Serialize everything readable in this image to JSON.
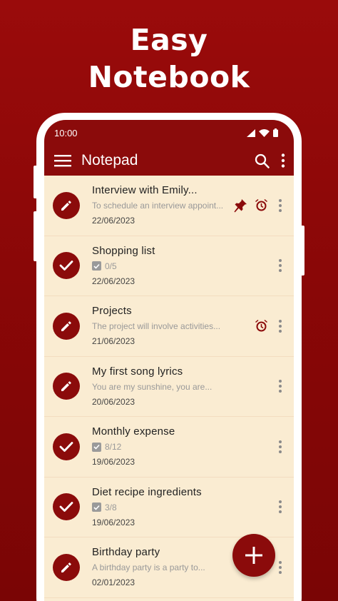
{
  "promo": {
    "line1": "Easy",
    "line2": "Notebook"
  },
  "status_bar": {
    "time": "10:00",
    "icons": [
      "signal-icon",
      "wifi-icon",
      "battery-icon"
    ]
  },
  "app_bar": {
    "title": "Notepad",
    "menu_icon": "hamburger-menu-icon",
    "search_icon": "search-icon",
    "more_icon": "more-vert-icon"
  },
  "colors": {
    "primary": "#8b0b0b",
    "background": "#faecd2",
    "promo_bg": "#8a0707"
  },
  "notes": [
    {
      "title": "Interview with Emily...",
      "preview": "To schedule an interview appoint...",
      "date": "22/06/2023",
      "type": "text",
      "pinned": true,
      "alarm": true
    },
    {
      "title": "Shopping list",
      "checklist": "0/5",
      "date": "22/06/2023",
      "type": "checklist"
    },
    {
      "title": "Projects",
      "preview": "The project will involve activities...",
      "date": "21/06/2023",
      "type": "text",
      "alarm": true
    },
    {
      "title": "My first song lyrics",
      "preview": "You are my sunshine, you are...",
      "date": "20/06/2023",
      "type": "text"
    },
    {
      "title": "Monthly expense",
      "checklist": "8/12",
      "date": "19/06/2023",
      "type": "checklist"
    },
    {
      "title": "Diet recipe ingredients",
      "checklist": "3/8",
      "date": "19/06/2023",
      "type": "checklist"
    },
    {
      "title": "Birthday party",
      "preview": "A birthday party is a party to...",
      "date": "02/01/2023",
      "type": "text"
    }
  ],
  "fab": {
    "icon": "plus-icon"
  }
}
